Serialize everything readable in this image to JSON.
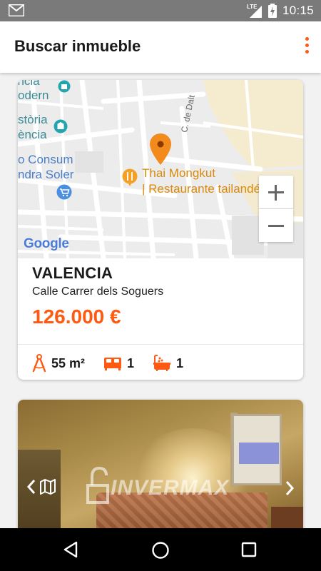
{
  "status_bar": {
    "time": "10:15",
    "network": "LTE",
    "icons": [
      "gmail-notification-icon",
      "lte-signal-icon",
      "battery-charging-icon"
    ]
  },
  "app_bar": {
    "title": "Buscar inmueble",
    "menu_icon": "more-vert-icon"
  },
  "listings": [
    {
      "map": {
        "labels": {
          "museum": "seu Modern",
          "museum_line1": "ència",
          "museum_line2": "odern",
          "history_line1": "stòria",
          "history_line2": "ència",
          "consum_line1": "o Consum",
          "consum_line2": "ndra Soler",
          "street": "C. de Dalt",
          "restaurant_line1": "Thai Mongkut",
          "restaurant_line2": "| Restaurante tailandés",
          "provider": "Google"
        },
        "zoom_in_label": "+",
        "zoom_out_label": "−"
      },
      "city": "VALENCIA",
      "street": "Calle Carrer dels Soguers",
      "price": "126.000 €",
      "features": {
        "area": "55 m²",
        "bedrooms": "1",
        "bathrooms": "1"
      }
    },
    {
      "photo": {
        "watermark": "INVERMAX",
        "prev_icon": "chevron-left-icon",
        "map_icon": "map-icon",
        "next_icon": "chevron-right-icon"
      }
    }
  ],
  "colors": {
    "accent": "#ff5a12",
    "status_bar": "#7a7a7a",
    "nav_bar": "#000000"
  }
}
